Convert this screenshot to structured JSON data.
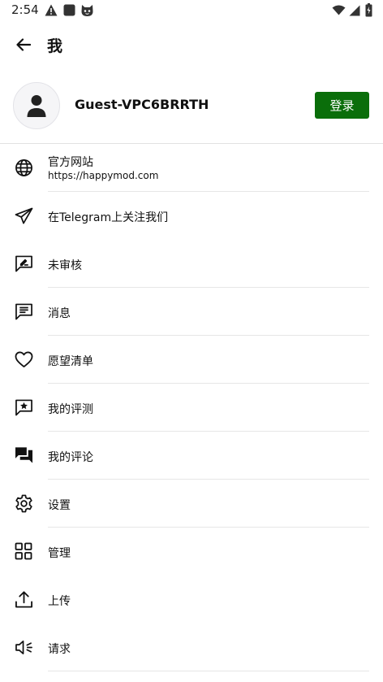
{
  "status_bar": {
    "time": "2:54",
    "left_icons": [
      "warning-icon",
      "square-notification-icon",
      "cat-face-icon"
    ],
    "right_icons": [
      "wifi-icon",
      "signal-icon",
      "battery-icon"
    ]
  },
  "app_bar": {
    "back_icon": "arrow-left-icon",
    "title": "我"
  },
  "profile": {
    "avatar_icon": "person-icon",
    "username": "Guest-VPC6BRRTH",
    "login_label": "登录",
    "login_color": "#0a6e0a"
  },
  "menu": [
    {
      "icon": "globe-icon",
      "label": "官方网站",
      "sublabel": "https://happymod.com"
    },
    {
      "icon": "telegram-send-icon",
      "label": "在Telegram上关注我们"
    },
    {
      "icon": "pending-review-icon",
      "label": "未审核"
    },
    {
      "icon": "message-icon",
      "label": "消息"
    },
    {
      "icon": "heart-icon",
      "label": "愿望清单"
    },
    {
      "icon": "review-star-icon",
      "label": "我的评测"
    },
    {
      "icon": "comments-icon",
      "label": "我的评论"
    },
    {
      "icon": "settings-gear-icon",
      "label": "设置"
    },
    {
      "icon": "grid-manage-icon",
      "label": "管理"
    },
    {
      "icon": "upload-icon",
      "label": "上传"
    },
    {
      "icon": "megaphone-icon",
      "label": "请求"
    }
  ]
}
